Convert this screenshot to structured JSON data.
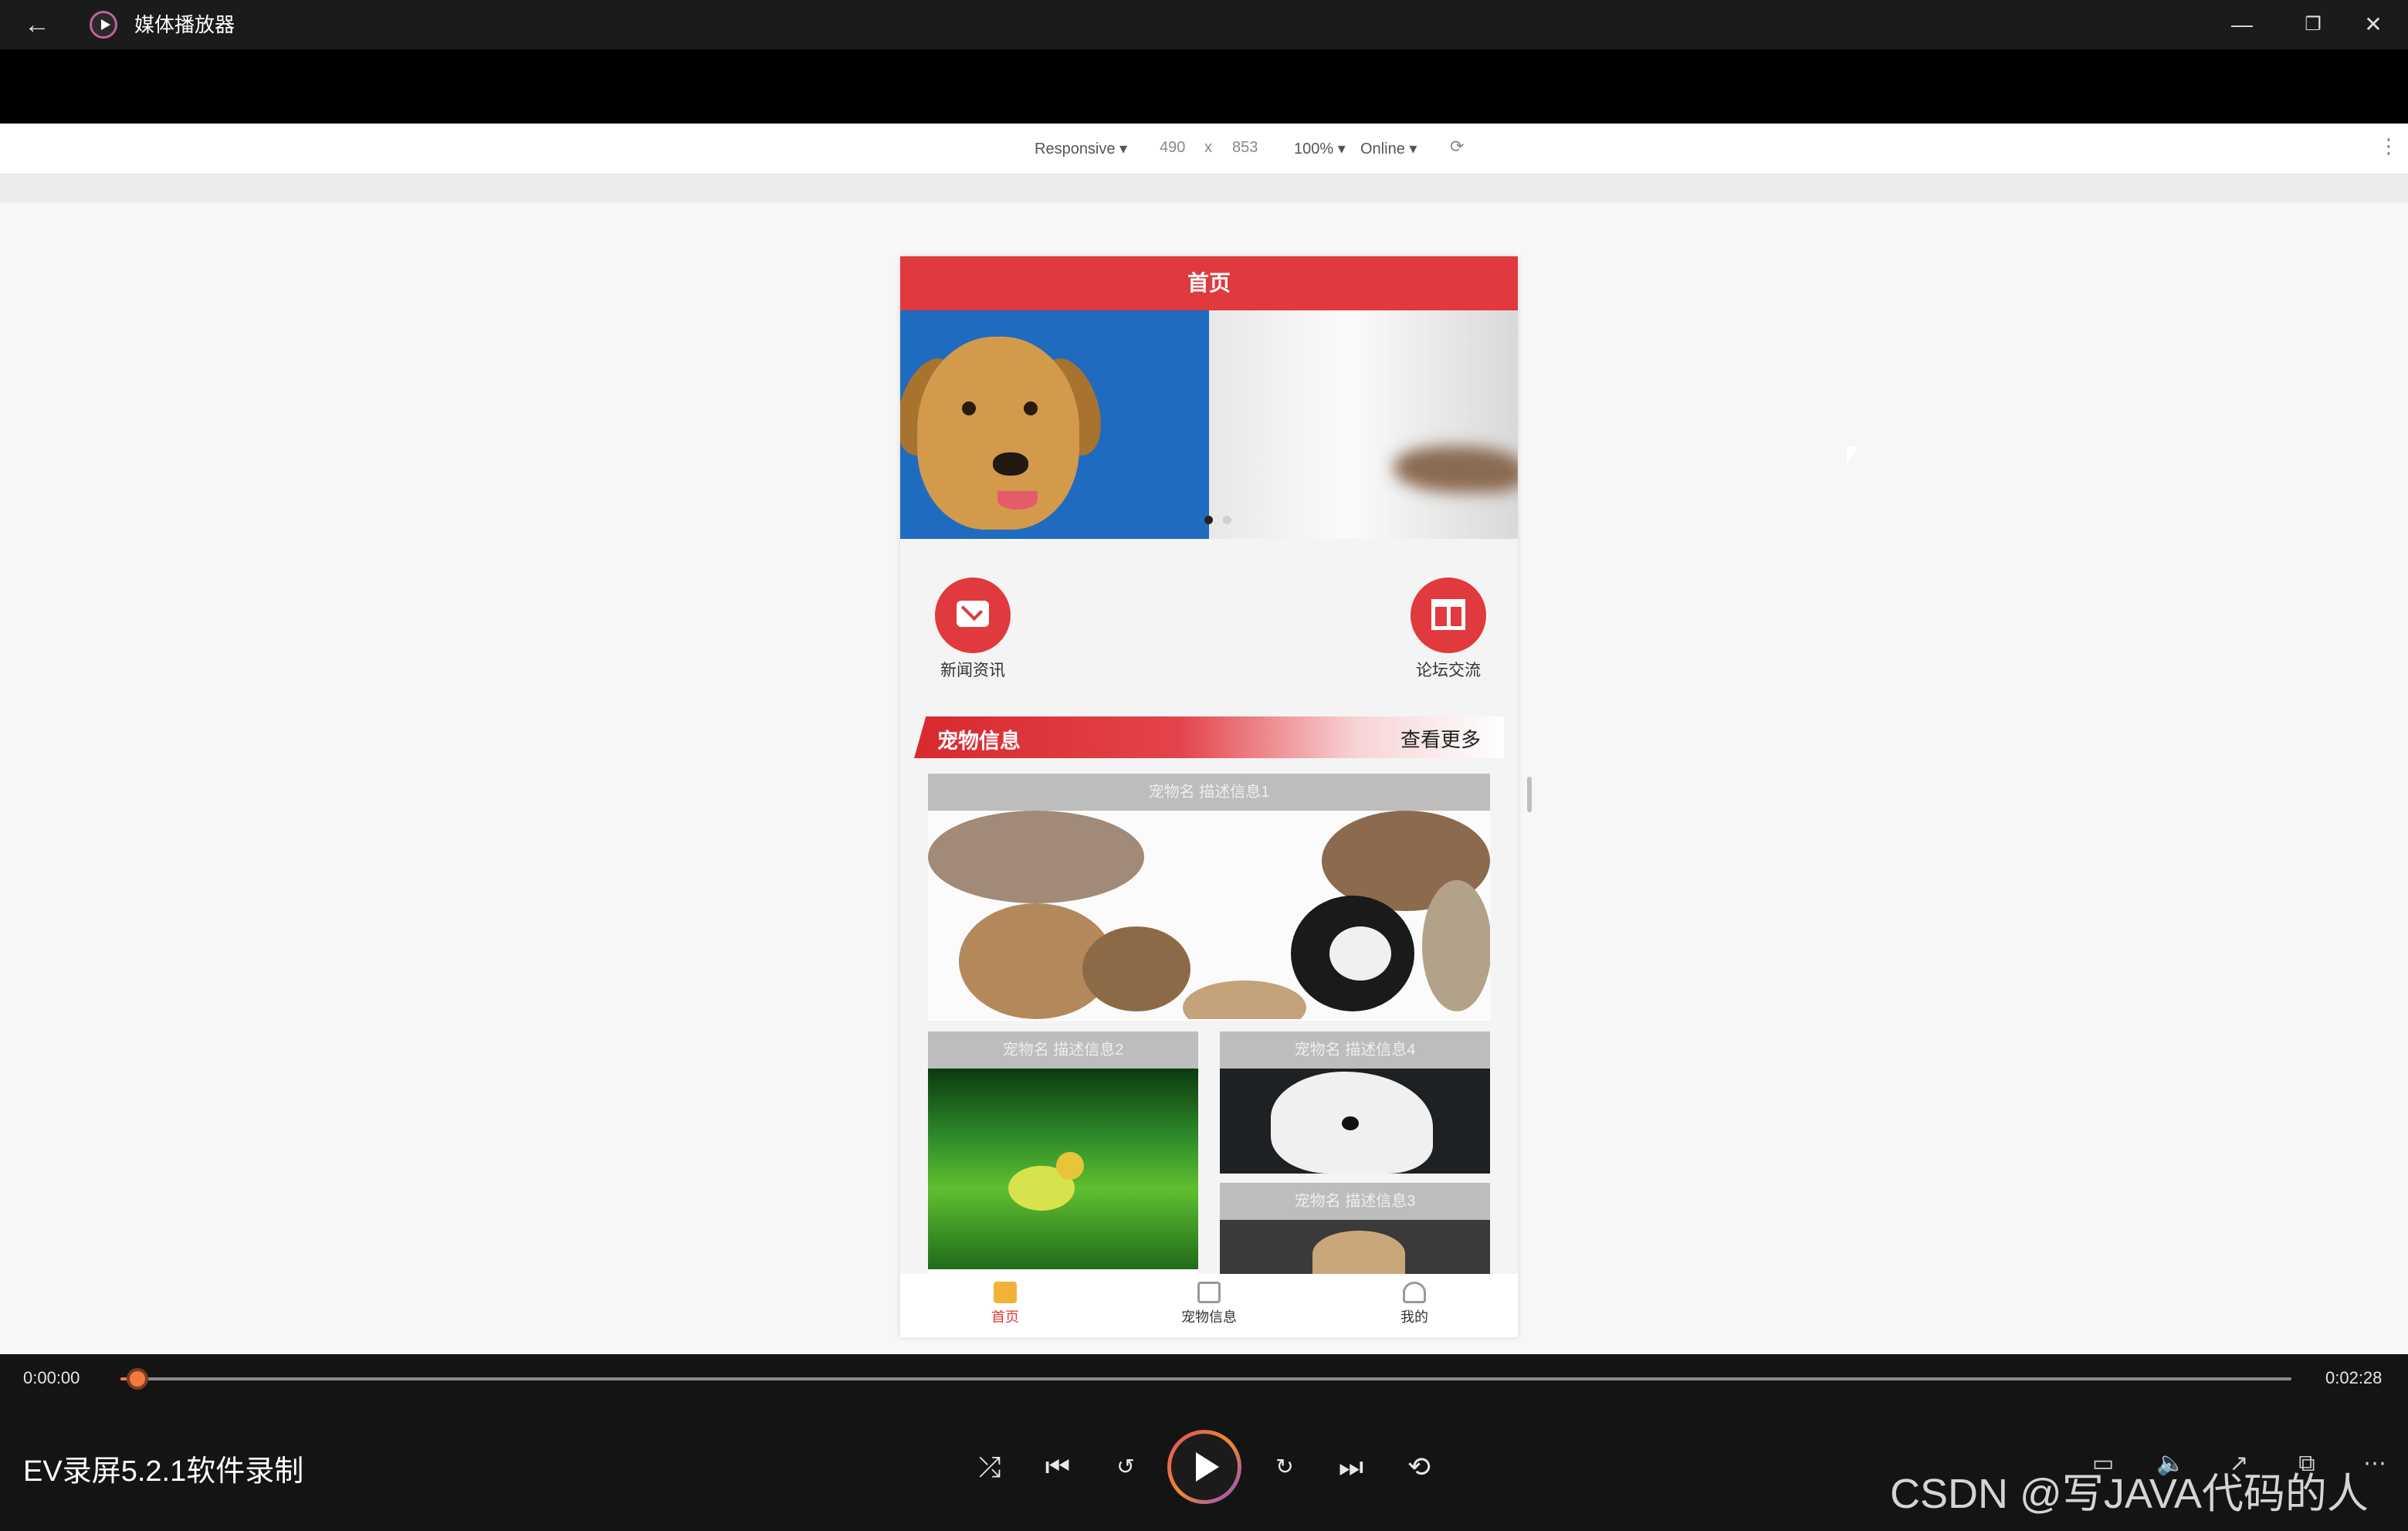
{
  "window": {
    "title": "媒体播放器",
    "back_icon": "←",
    "min_icon": "—",
    "max_icon": "❐",
    "close_icon": "✕"
  },
  "devtools": {
    "device": "Responsive ▾",
    "width": "490",
    "x": "x",
    "height": "853",
    "zoom": "100% ▾",
    "network": "Online ▾",
    "rotate_icon": "⟳",
    "more_icon": "⋮"
  },
  "app": {
    "header_title": "首页",
    "nav": [
      {
        "label": "新闻资讯"
      },
      {
        "label": "论坛交流"
      }
    ],
    "section_title": "宠物信息",
    "section_more": "查看更多",
    "cards": [
      {
        "caption": "宠物名 描述信息1"
      },
      {
        "caption": "宠物名 描述信息2"
      },
      {
        "caption": "宠物名 描述信息4"
      },
      {
        "caption": "宠物名 描述信息3"
      }
    ],
    "tabs": [
      {
        "label": "首页",
        "active": true
      },
      {
        "label": "宠物信息",
        "active": false
      },
      {
        "label": "我的",
        "active": false
      }
    ],
    "carousel_active_index": 0
  },
  "player": {
    "current_time": "0:00:00",
    "total_time": "0:02:28",
    "progress": 0.004,
    "recording_label": "EV录屏5.2.1软件录制",
    "watermark": "CSDN @写JAVA代码的人"
  },
  "colors": {
    "accent": "#e0393e",
    "progress": "#f07a3d",
    "titlebar": "#1b1b1b"
  }
}
